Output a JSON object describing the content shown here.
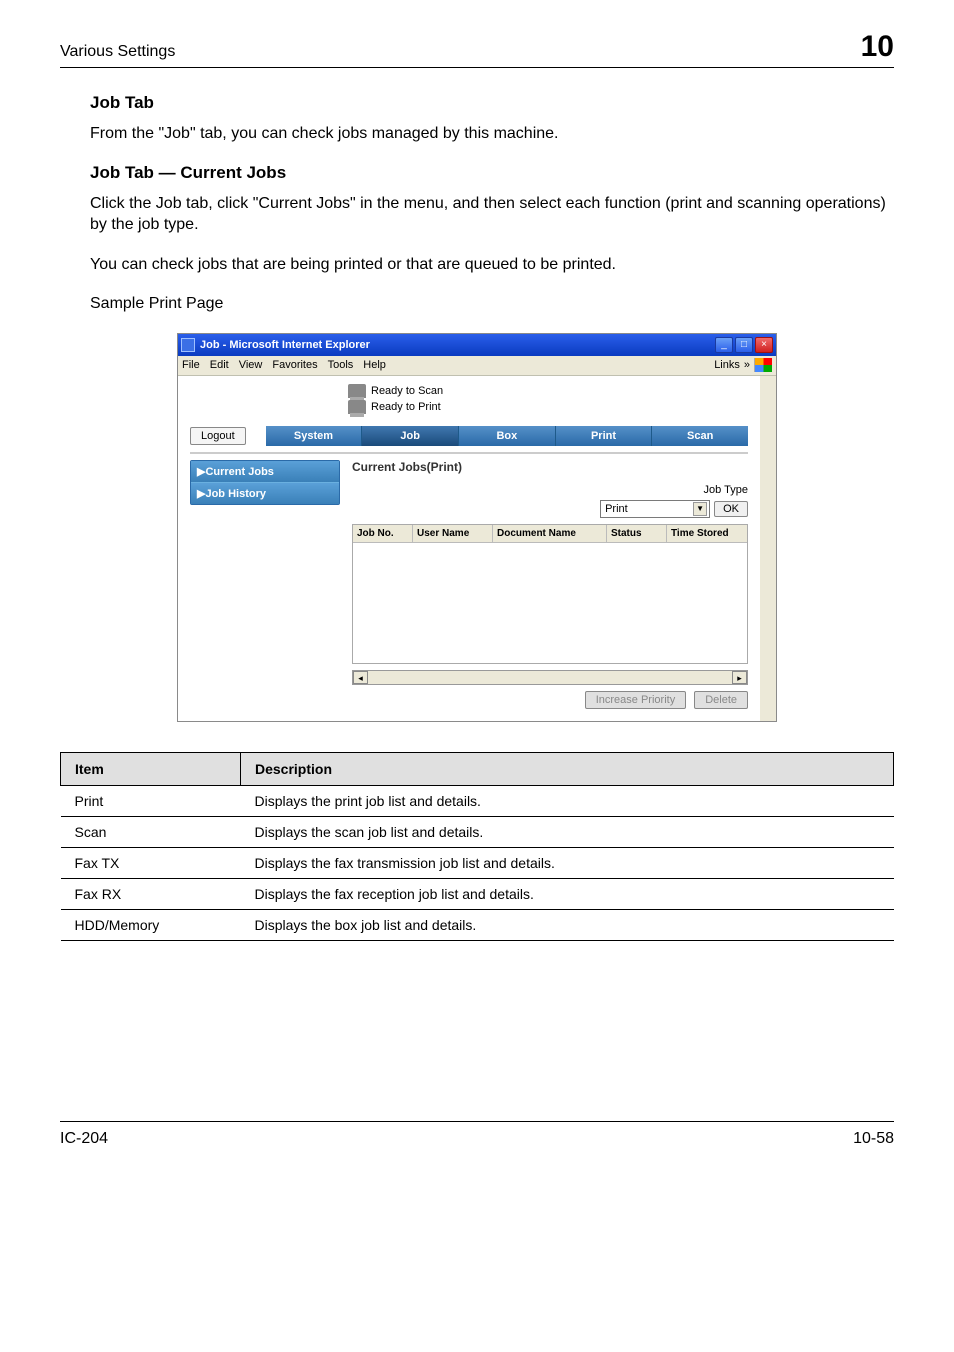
{
  "header": {
    "left": "Various Settings",
    "right": "10"
  },
  "section1": {
    "heading": "Job Tab",
    "text": "From the \"Job\" tab, you can check jobs managed by this machine."
  },
  "section2": {
    "heading": "Job Tab — Current Jobs",
    "para1": "Click the Job tab, click \"Current Jobs\" in the menu, and then select each function (print and scanning operations) by the job type.",
    "para2": "You can check jobs that are being printed or that are queued to be printed.",
    "para3": "Sample Print Page"
  },
  "screenshot": {
    "window_title": "Job - Microsoft Internet Explorer",
    "menus": {
      "file": "File",
      "edit": "Edit",
      "view": "View",
      "favorites": "Favorites",
      "tools": "Tools",
      "help": "Help",
      "links": "Links"
    },
    "status": {
      "scan": "Ready to Scan",
      "print": "Ready to Print"
    },
    "logout": "Logout",
    "tabs": {
      "system": "System",
      "job": "Job",
      "box": "Box",
      "print": "Print",
      "scan": "Scan"
    },
    "side": {
      "current": "▶Current Jobs",
      "history": "▶Job History"
    },
    "panel": {
      "title": "Current Jobs(Print)",
      "jobtype_label": "Job Type",
      "select_value": "Print",
      "ok": "OK",
      "cols": {
        "jobno": "Job No.",
        "user": "User Name",
        "docname": "Document Name",
        "status": "Status",
        "time": "Time Stored"
      },
      "increase": "Increase Priority",
      "delete": "Delete"
    }
  },
  "table": {
    "h_item": "Item",
    "h_desc": "Description",
    "rows": [
      {
        "item": "Print",
        "desc": "Displays the print job list and details."
      },
      {
        "item": "Scan",
        "desc": "Displays the scan job list and details."
      },
      {
        "item": "Fax TX",
        "desc": "Displays the fax transmission job list and details."
      },
      {
        "item": "Fax RX",
        "desc": "Displays the fax reception job list and details."
      },
      {
        "item": "HDD/Memory",
        "desc": "Displays the box job list and details."
      }
    ]
  },
  "footer": {
    "left": "IC-204",
    "right": "10-58"
  }
}
